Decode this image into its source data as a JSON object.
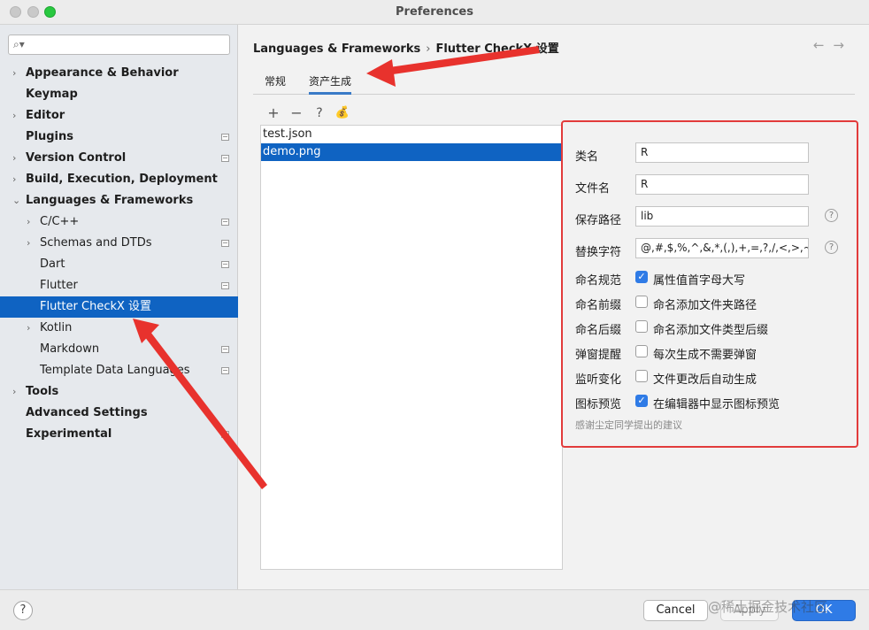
{
  "window": {
    "title": "Preferences"
  },
  "sidebar": {
    "search": {
      "placeholder": ""
    },
    "items": [
      {
        "label": "Appearance & Behavior",
        "level": 0,
        "expandable": true,
        "bold": true,
        "project": false
      },
      {
        "label": "Keymap",
        "level": 0,
        "expandable": false,
        "bold": true,
        "project": false
      },
      {
        "label": "Editor",
        "level": 0,
        "expandable": true,
        "bold": true,
        "project": false
      },
      {
        "label": "Plugins",
        "level": 0,
        "expandable": false,
        "bold": true,
        "project": true
      },
      {
        "label": "Version Control",
        "level": 0,
        "expandable": true,
        "bold": true,
        "project": true
      },
      {
        "label": "Build, Execution, Deployment",
        "level": 0,
        "expandable": true,
        "bold": true,
        "project": false
      },
      {
        "label": "Languages & Frameworks",
        "level": 0,
        "expandable": true,
        "expanded": true,
        "bold": true,
        "project": false
      },
      {
        "label": "C/C++",
        "level": 1,
        "expandable": true,
        "bold": false,
        "project": true
      },
      {
        "label": "Schemas and DTDs",
        "level": 1,
        "expandable": true,
        "bold": false,
        "project": true
      },
      {
        "label": "Dart",
        "level": 1,
        "expandable": false,
        "bold": false,
        "project": true
      },
      {
        "label": "Flutter",
        "level": 1,
        "expandable": false,
        "bold": false,
        "project": true
      },
      {
        "label": "Flutter CheckX 设置",
        "level": 1,
        "expandable": false,
        "bold": false,
        "project": false,
        "selected": true
      },
      {
        "label": "Kotlin",
        "level": 1,
        "expandable": true,
        "bold": false,
        "project": false
      },
      {
        "label": "Markdown",
        "level": 1,
        "expandable": false,
        "bold": false,
        "project": true
      },
      {
        "label": "Template Data Languages",
        "level": 1,
        "expandable": false,
        "bold": false,
        "project": true
      },
      {
        "label": "Tools",
        "level": 0,
        "expandable": true,
        "bold": true,
        "project": false
      },
      {
        "label": "Advanced Settings",
        "level": 0,
        "expandable": false,
        "bold": true,
        "project": false
      },
      {
        "label": "Experimental",
        "level": 0,
        "expandable": false,
        "bold": true,
        "project": true
      }
    ]
  },
  "breadcrumb": {
    "parent": "Languages & Frameworks",
    "separator": "›",
    "current": "Flutter CheckX 设置"
  },
  "tabs": [
    {
      "label": "常规",
      "active": false
    },
    {
      "label": "资产生成",
      "active": true
    }
  ],
  "toolbar": {
    "add": "+",
    "remove": "−",
    "help": "?",
    "extra": "💰"
  },
  "files": [
    {
      "name": "test.json",
      "selected": false
    },
    {
      "name": "demo.png",
      "selected": true
    }
  ],
  "form": {
    "class_name": {
      "label": "类名",
      "value": "R"
    },
    "file_name": {
      "label": "文件名",
      "value": "R"
    },
    "save_path": {
      "label": "保存路径",
      "value": "lib"
    },
    "replace_chars": {
      "label": "替换字符",
      "value": "@,#,$,%,^,&,*,(,),+,=,?,/,<,>,~"
    },
    "checks": [
      {
        "label": "命名规范",
        "text": "属性值首字母大写",
        "checked": true
      },
      {
        "label": "命名前缀",
        "text": "命名添加文件夹路径",
        "checked": false
      },
      {
        "label": "命名后缀",
        "text": "命名添加文件类型后缀",
        "checked": false
      },
      {
        "label": "弹窗提醒",
        "text": "每次生成不需要弹窗",
        "checked": false
      },
      {
        "label": "监听变化",
        "text": "文件更改后自动生成",
        "checked": false
      },
      {
        "label": "图标预览",
        "text": "在编辑器中显示图标预览",
        "checked": true
      }
    ],
    "thanks": "感谢尘定同学提出的建议"
  },
  "footer": {
    "cancel": "Cancel",
    "apply": "Apply",
    "ok": "OK",
    "watermark": "@稀土掘金技术社区"
  },
  "colors": {
    "accent": "#2f7be6",
    "selection": "#0f63c2",
    "annotation": "#e23b3b"
  }
}
